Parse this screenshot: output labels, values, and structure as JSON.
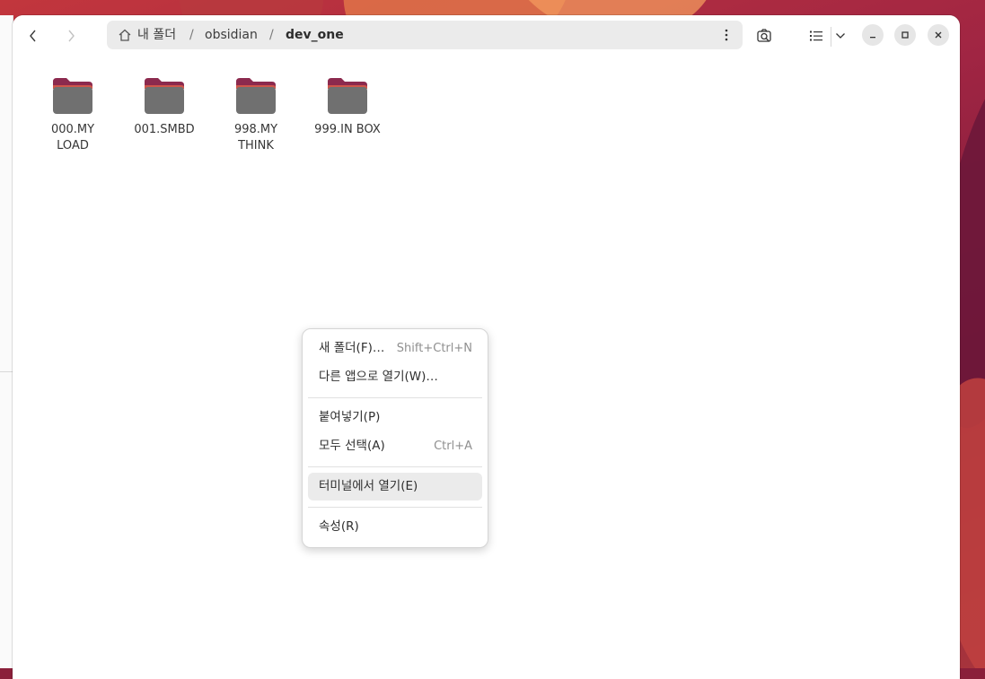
{
  "colors": {
    "accent_folder_top": "#8c2a4e",
    "folder_body": "#707070",
    "window_bg": "#ffffff",
    "pathbar_bg": "#ebebeb",
    "menu_hover": "#ebebeb"
  },
  "header": {
    "back_icon": "chevron-left-icon",
    "forward_icon": "chevron-right-icon",
    "breadcrumb": {
      "home_label": "내 폴더",
      "sep": "/",
      "items": [
        "obsidian",
        "dev_one"
      ]
    },
    "path_menu_icon": "vertical-ellipsis-icon",
    "search_icon": "search-icon",
    "view_icon": "list-view-icon",
    "view_dropdown_icon": "chevron-down-icon",
    "window_controls": [
      "minimize-icon",
      "maximize-icon",
      "close-icon"
    ]
  },
  "files": [
    {
      "name_lines": [
        "000.MY",
        "LOAD"
      ]
    },
    {
      "name_lines": [
        "001.SMBD"
      ]
    },
    {
      "name_lines": [
        "998.MY",
        "THINK"
      ]
    },
    {
      "name_lines": [
        "999.IN BOX"
      ]
    }
  ],
  "context_menu": {
    "groups": [
      [
        {
          "label": "새 폴더(F)…",
          "shortcut": "Shift+Ctrl+N"
        },
        {
          "label": "다른 앱으로 열기(W)…",
          "shortcut": ""
        }
      ],
      [
        {
          "label": "붙여넣기(P)",
          "shortcut": ""
        },
        {
          "label": "모두 선택(A)",
          "shortcut": "Ctrl+A"
        }
      ],
      [
        {
          "label": "터미널에서 열기(E)",
          "shortcut": "",
          "highlighted": true
        }
      ],
      [
        {
          "label": "속성(R)",
          "shortcut": ""
        }
      ]
    ]
  }
}
